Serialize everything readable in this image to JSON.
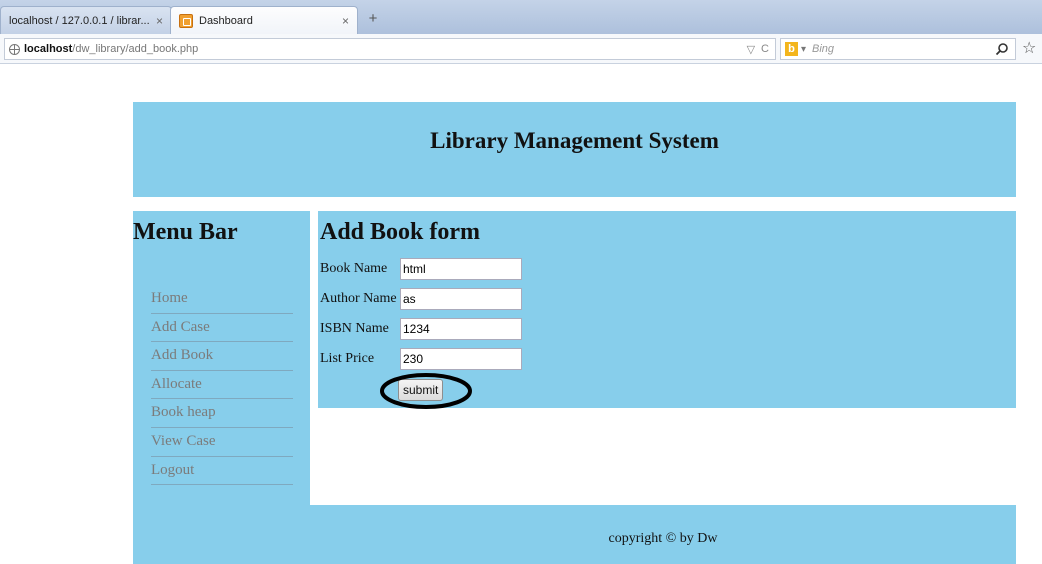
{
  "browser": {
    "tabs": [
      {
        "label": "localhost / 127.0.0.1 / librar...",
        "close": "×"
      },
      {
        "label": "Dashboard",
        "close": "×"
      }
    ],
    "new_tab": "+",
    "url_host": "localhost",
    "url_path": "/dw_library/add_book.php",
    "url_controls": {
      "dropdown": "▽",
      "reload": "C"
    },
    "search_placeholder": "Bing",
    "search_engine_icon": "b"
  },
  "page": {
    "title": "Library Management System",
    "menu": {
      "title": "Menu Bar",
      "items": [
        "Home",
        "Add Case",
        "Add Book",
        "Allocate",
        "Book heap",
        "View Case",
        "Logout"
      ]
    },
    "form": {
      "title": "Add Book form",
      "fields": [
        {
          "label": "Book Name",
          "value": "html"
        },
        {
          "label": "Author Name",
          "value": "as"
        },
        {
          "label": "ISBN Name",
          "value": "1234"
        },
        {
          "label": "List Price",
          "value": "230"
        }
      ],
      "submit_label": "submit"
    },
    "footer": "copyright © by Dw"
  },
  "colors": {
    "panel": "#87ceeb",
    "menu_text": "#7b7b7b",
    "annotation": "#000000"
  }
}
